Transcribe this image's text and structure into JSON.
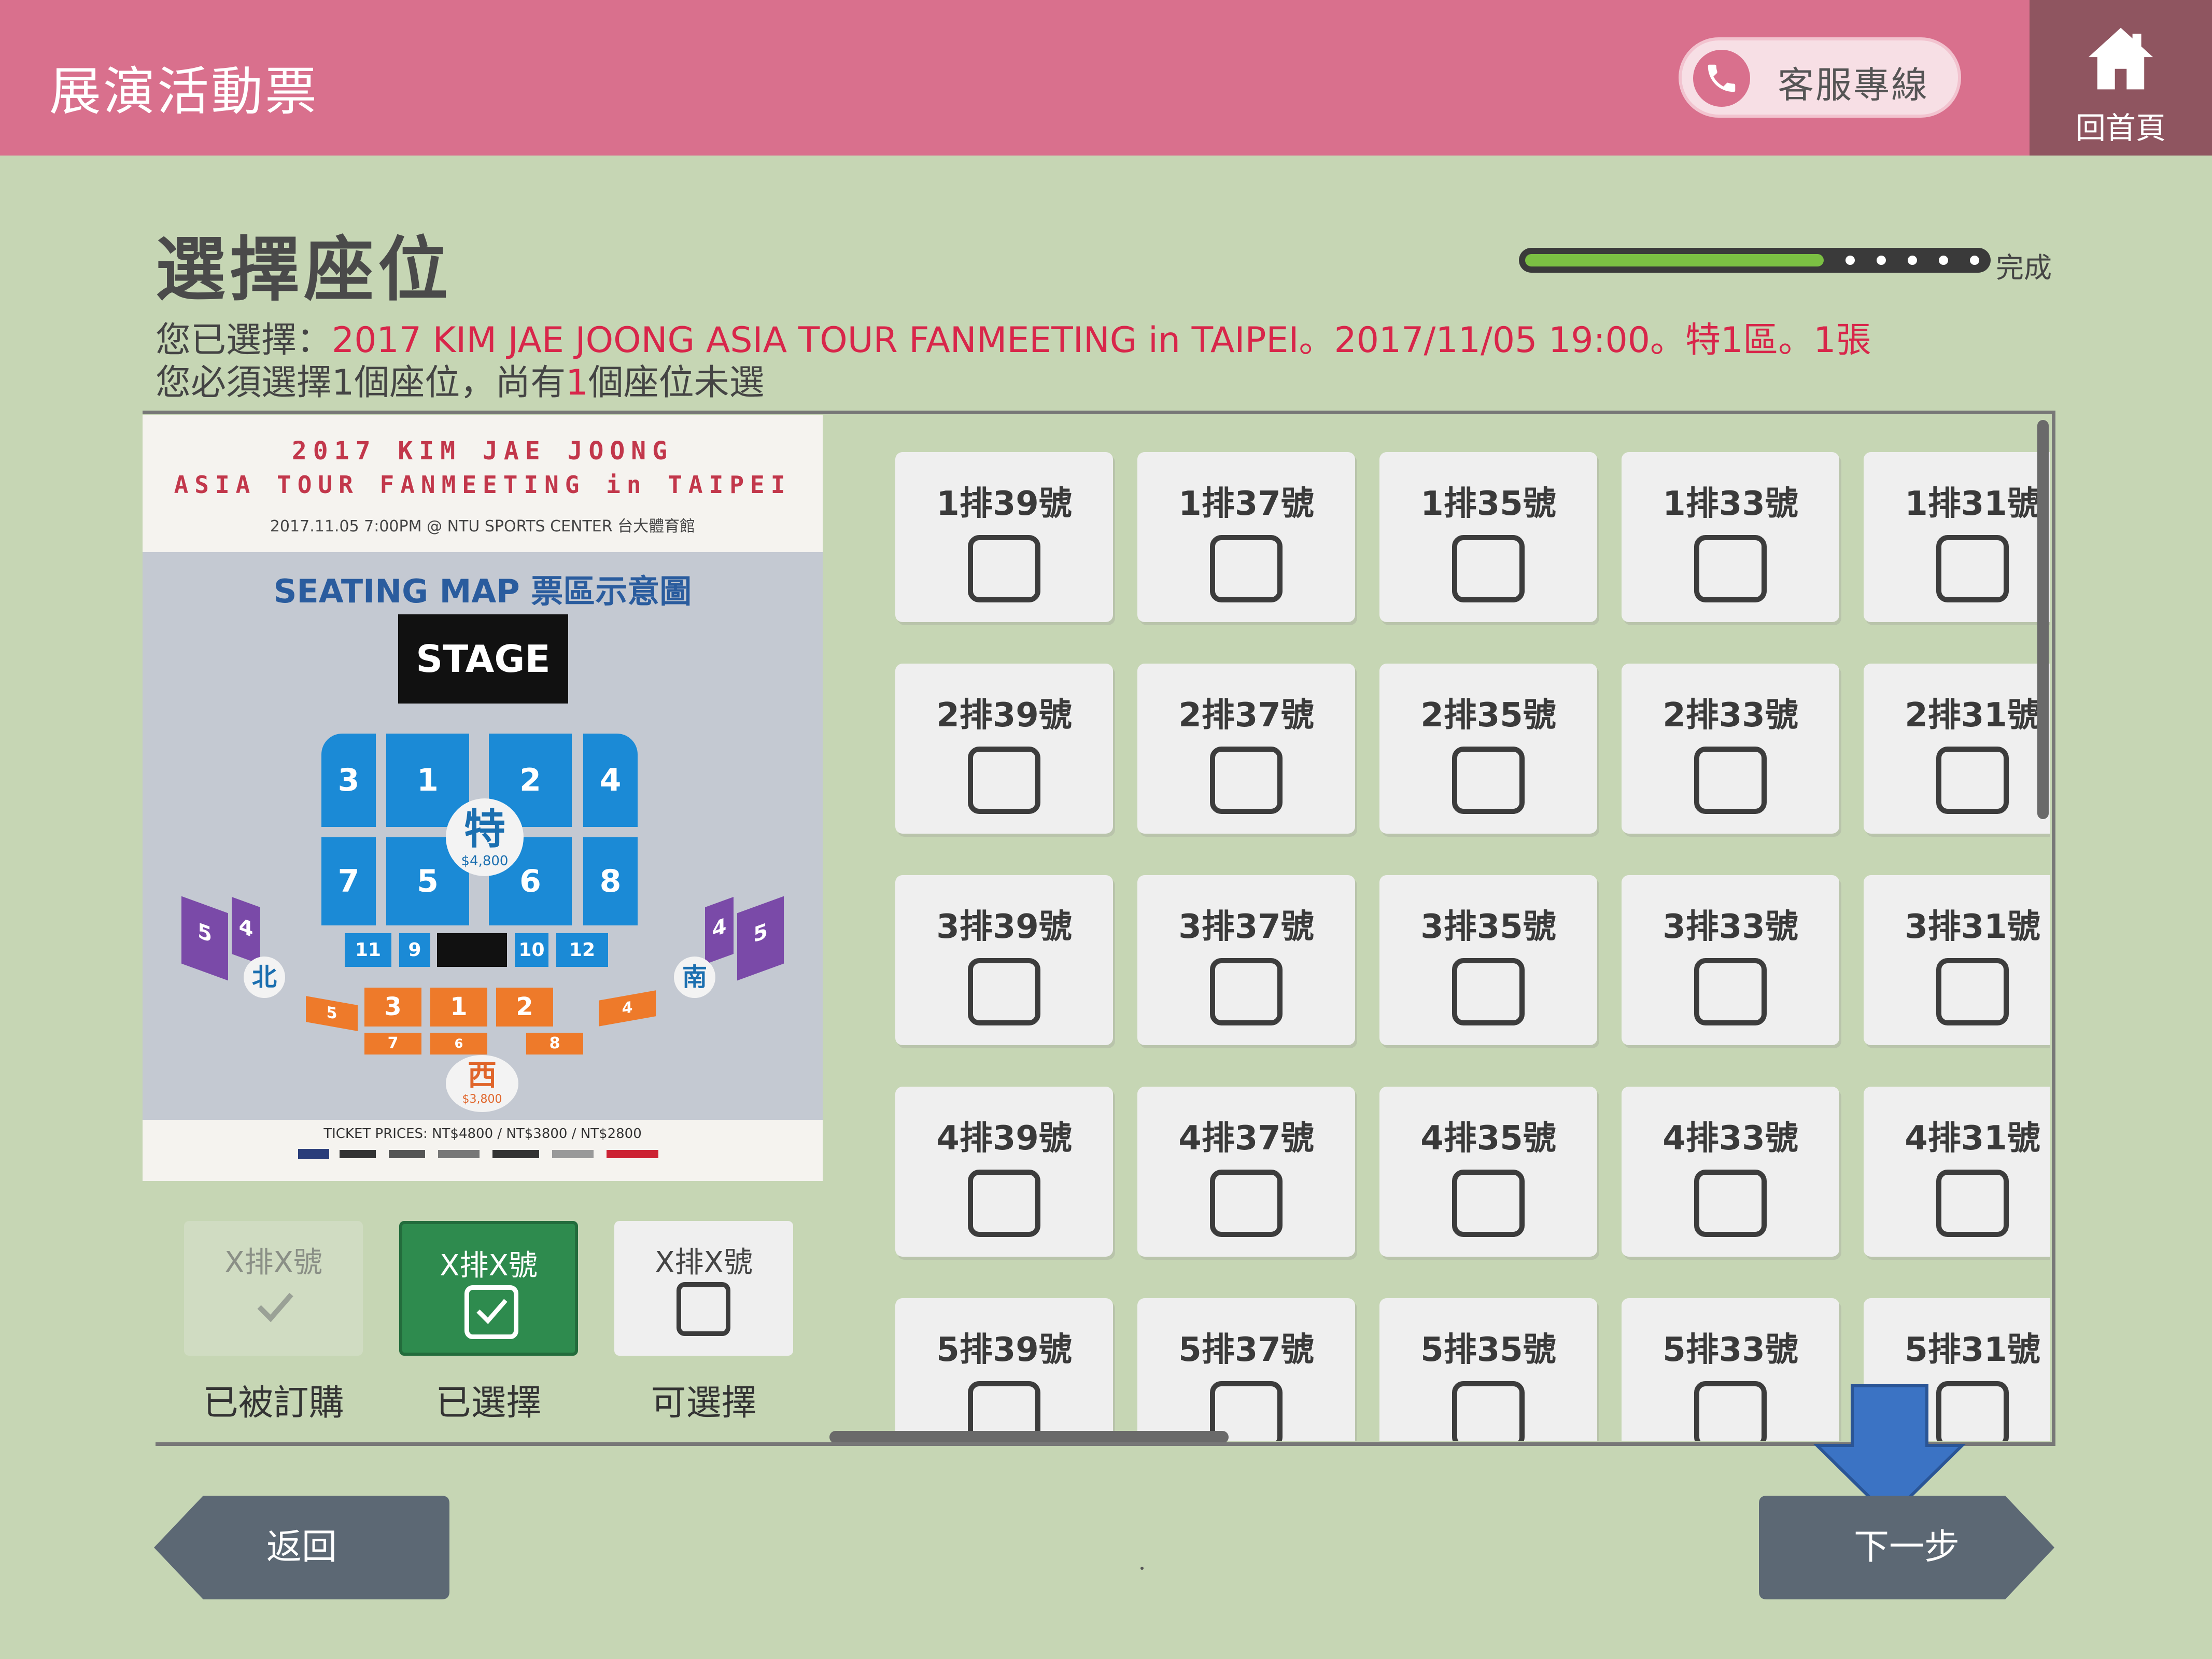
{
  "header": {
    "app_title": "展演活動票",
    "service_label": "客服專線",
    "home_label": "回首頁"
  },
  "page": {
    "title": "選擇座位",
    "progress_label": "完成",
    "progress_fraction": 0.65,
    "summary_prefix": "您已選擇：",
    "summary_selection": "2017 KIM JAE JOONG ASIA TOUR FANMEETING in TAIPEI。2017/11/05 19:00。特1區。1張",
    "requirement_a": "您必須選擇",
    "requirement_count": "1",
    "requirement_b": "個座位，尚有",
    "requirement_remaining": "1",
    "requirement_c": "個座位未選"
  },
  "seat_map": {
    "line1": "2017 KIM JAE JOONG",
    "line2": "ASIA TOUR FANMEETING in TAIPEI",
    "line3": "2017.11.05 7:00PM @ NTU SPORTS CENTER 台大體育館",
    "subtitle": "SEATING MAP 票區示意圖",
    "stage": "STAGE",
    "special_label": "特",
    "special_price": "$4,800",
    "north_label": "北",
    "south_label": "南",
    "west_label": "西",
    "west_price": "$3,800",
    "ticket_prices": "TICKET PRICES: NT$4800 / NT$3800 / NT$2800",
    "blue_blocks": [
      "3",
      "1",
      "2",
      "4",
      "7",
      "5",
      "6",
      "8",
      "11",
      "9",
      "10",
      "12"
    ],
    "orange_blocks": [
      "5",
      "3",
      "1",
      "2",
      "4",
      "7",
      "6",
      "8"
    ],
    "purple_blocks": [
      "5",
      "4",
      "4",
      "5"
    ]
  },
  "legend": [
    {
      "sample": "X排X號",
      "caption": "已被訂購",
      "state": "booked"
    },
    {
      "sample": "X排X號",
      "caption": "已選擇",
      "state": "selected"
    },
    {
      "sample": "X排X號",
      "caption": "可選擇",
      "state": "available"
    }
  ],
  "seats": [
    [
      "1排39號",
      "1排37號",
      "1排35號",
      "1排33號",
      "1排31號"
    ],
    [
      "2排39號",
      "2排37號",
      "2排35號",
      "2排33號",
      "2排31號"
    ],
    [
      "3排39號",
      "3排37號",
      "3排35號",
      "3排33號",
      "3排31號"
    ],
    [
      "4排39號",
      "4排37號",
      "4排35號",
      "4排33號",
      "4排31號"
    ],
    [
      "5排39號",
      "5排37號",
      "5排35號",
      "5排33號",
      "5排31號"
    ]
  ],
  "footer": {
    "back_label": "返回",
    "next_label": "下一步"
  },
  "colors": {
    "header": "#d9708d",
    "home": "#8f5560",
    "background": "#c6d6b4",
    "highlight": "#d8264a",
    "selected": "#2e8b4e",
    "nav_button": "#5c6874",
    "arrow": "#3b73c4"
  }
}
